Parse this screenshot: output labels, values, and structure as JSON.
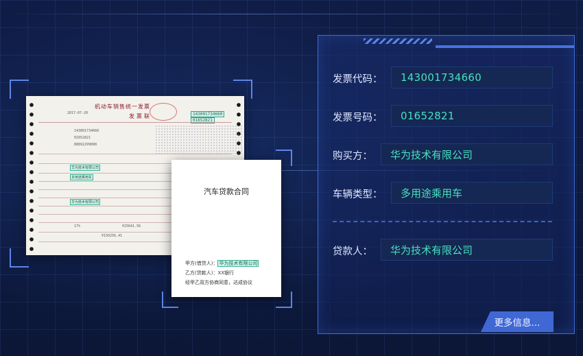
{
  "invoice": {
    "title": "机动车销售统一发票",
    "subtitle": "发票联",
    "code_box_1": "143001734660",
    "code_box_2": "01652821",
    "date": "2017-07-20",
    "lines": [
      "143001734660",
      "01652821",
      "88892299088"
    ],
    "buyer_hl": "华为技术有限公司",
    "vehicle_type_hl": "多用途乘用车",
    "seller_hl": "华为技术有限公司",
    "amount": "¥25641.56",
    "total": "¥150256.41",
    "tax_rate": "17%"
  },
  "contract": {
    "title": "汽车贷款合同",
    "party_a_label": "甲方(借贷人)：",
    "party_a_value": "华为技术有限公司",
    "party_b": "乙方(贷款人)：XX银行",
    "agreement": "经甲乙双方协商同意，达成协议"
  },
  "panel": {
    "fields": [
      {
        "label": "发票代码：",
        "value": "143001734660"
      },
      {
        "label": "发票号码：",
        "value": "01652821"
      },
      {
        "label": "购买方：",
        "value": "华为技术有限公司"
      },
      {
        "label": "车辆类型：",
        "value": "多用途乘用车"
      }
    ],
    "lender": {
      "label": "贷款人：",
      "value": "华为技术有限公司"
    },
    "more_button": "更多信息..."
  },
  "colors": {
    "background": "#0e1a3f",
    "panel_border": "#3f6bd6",
    "value_text": "#48e0c0",
    "button": "#3f68d4"
  }
}
